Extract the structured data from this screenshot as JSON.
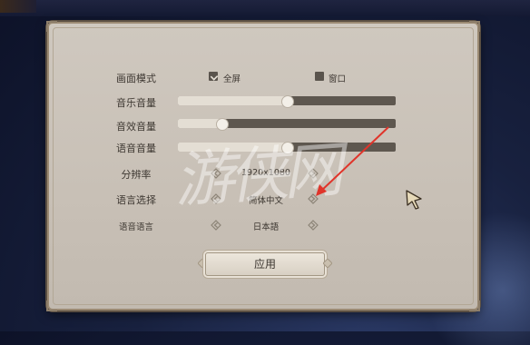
{
  "settings": {
    "display_mode": {
      "label": "画面模式",
      "fullscreen": "全屏",
      "windowed": "窗口",
      "selected": "fullscreen"
    },
    "music_volume": {
      "label": "音乐音量",
      "value": 0.5
    },
    "sfx_volume": {
      "label": "音效音量",
      "value": 0.2
    },
    "voice_volume": {
      "label": "语音音量",
      "value": 0.5
    },
    "resolution": {
      "label": "分辨率",
      "value": "1920x1080"
    },
    "language": {
      "label": "语言选择",
      "value": "简体中文"
    },
    "voice_language": {
      "label": "语音语言",
      "value": "日本語"
    }
  },
  "apply_label": "应用",
  "watermark": "游侠网",
  "colors": {
    "panel": "#cfc8bf",
    "track": "#5e574f",
    "fill": "#e4ded4",
    "annotation": "#e0342a"
  }
}
